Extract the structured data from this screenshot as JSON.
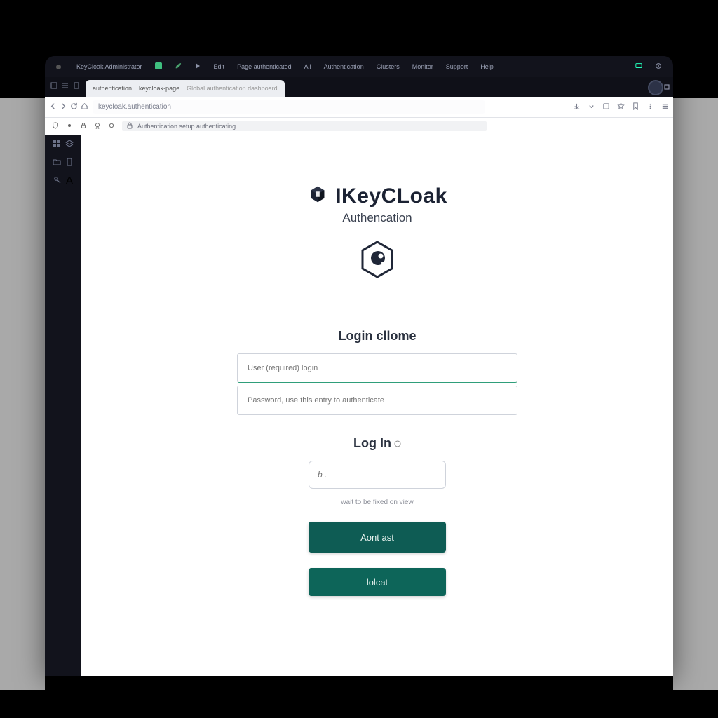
{
  "menubar": {
    "app": "KeyCloak Administrator",
    "items": [
      "Edit",
      "Page authenticated",
      "All",
      "Authentication",
      "Clusters",
      "Monitor",
      "Support",
      "Help"
    ]
  },
  "tabs": {
    "active": {
      "title": "authentication",
      "title2": "keycloak-page",
      "title3": "Global authentication dashboard"
    }
  },
  "address": {
    "value": "keycloak.authentication"
  },
  "toolbar2": {
    "info": "Authentication setup authenticating…"
  },
  "brand": {
    "name_pre": "IKey",
    "name_mid": "CL",
    "name_post": "oak",
    "subtitle": "Authencation"
  },
  "form": {
    "header": "Login cllome",
    "username_placeholder": "User (required) login",
    "password_placeholder": "Password, use this entry to authenticate",
    "login_label": "Log In",
    "code_placeholder": "b .",
    "helper": "wait to be fixed on view",
    "primary_btn": "Aont ast",
    "secondary_btn": "lolcat"
  }
}
